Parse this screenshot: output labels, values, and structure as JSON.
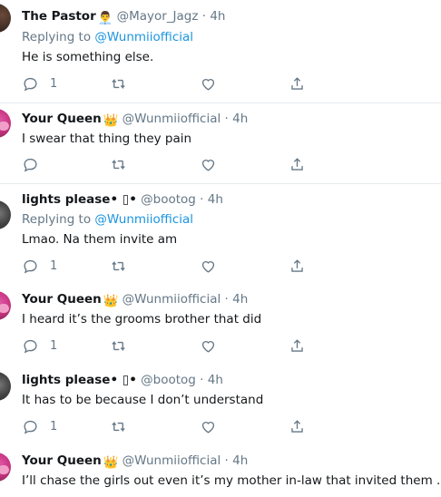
{
  "tweets": [
    {
      "name": "The Pastor",
      "emoji": "👨‍💼",
      "handle": "@Mayor_Jagz",
      "time": "4h",
      "replying_prefix": "Replying to",
      "replying_to": "@Wunmiiofficial",
      "text": "He is something else.",
      "reply_count": "1"
    },
    {
      "name": "Your Queen",
      "emoji": "👑",
      "handle": "@Wunmiiofficial",
      "time": "4h",
      "text": "I swear that thing they pain",
      "reply_count": ""
    },
    {
      "name": "lights please• ▯•",
      "handle": "@bootog",
      "time": "4h",
      "replying_prefix": "Replying to",
      "replying_to": "@Wunmiiofficial",
      "text": "Lmao. Na them invite am",
      "reply_count": "1"
    },
    {
      "name": "Your Queen",
      "emoji": "👑",
      "handle": "@Wunmiiofficial",
      "time": "4h",
      "text": "I heard it’s the grooms brother that did",
      "reply_count": "1"
    },
    {
      "name": "lights please• ▯•",
      "handle": "@bootog",
      "time": "4h",
      "text": "It has to be because I don’t understand",
      "reply_count": "1"
    },
    {
      "name": "Your Queen",
      "emoji": "👑",
      "handle": "@Wunmiiofficial",
      "time": "4h",
      "text": "I’ll chase the girls out even it’s my mother in-law that invited them .",
      "reply_count": ""
    }
  ],
  "separator": "·",
  "colors": {
    "link": "#1b95e0",
    "muted": "#657786",
    "text": "#14171a",
    "divider": "#e6ecf0"
  },
  "icons": [
    "reply-icon",
    "retweet-icon",
    "like-icon",
    "share-icon"
  ]
}
